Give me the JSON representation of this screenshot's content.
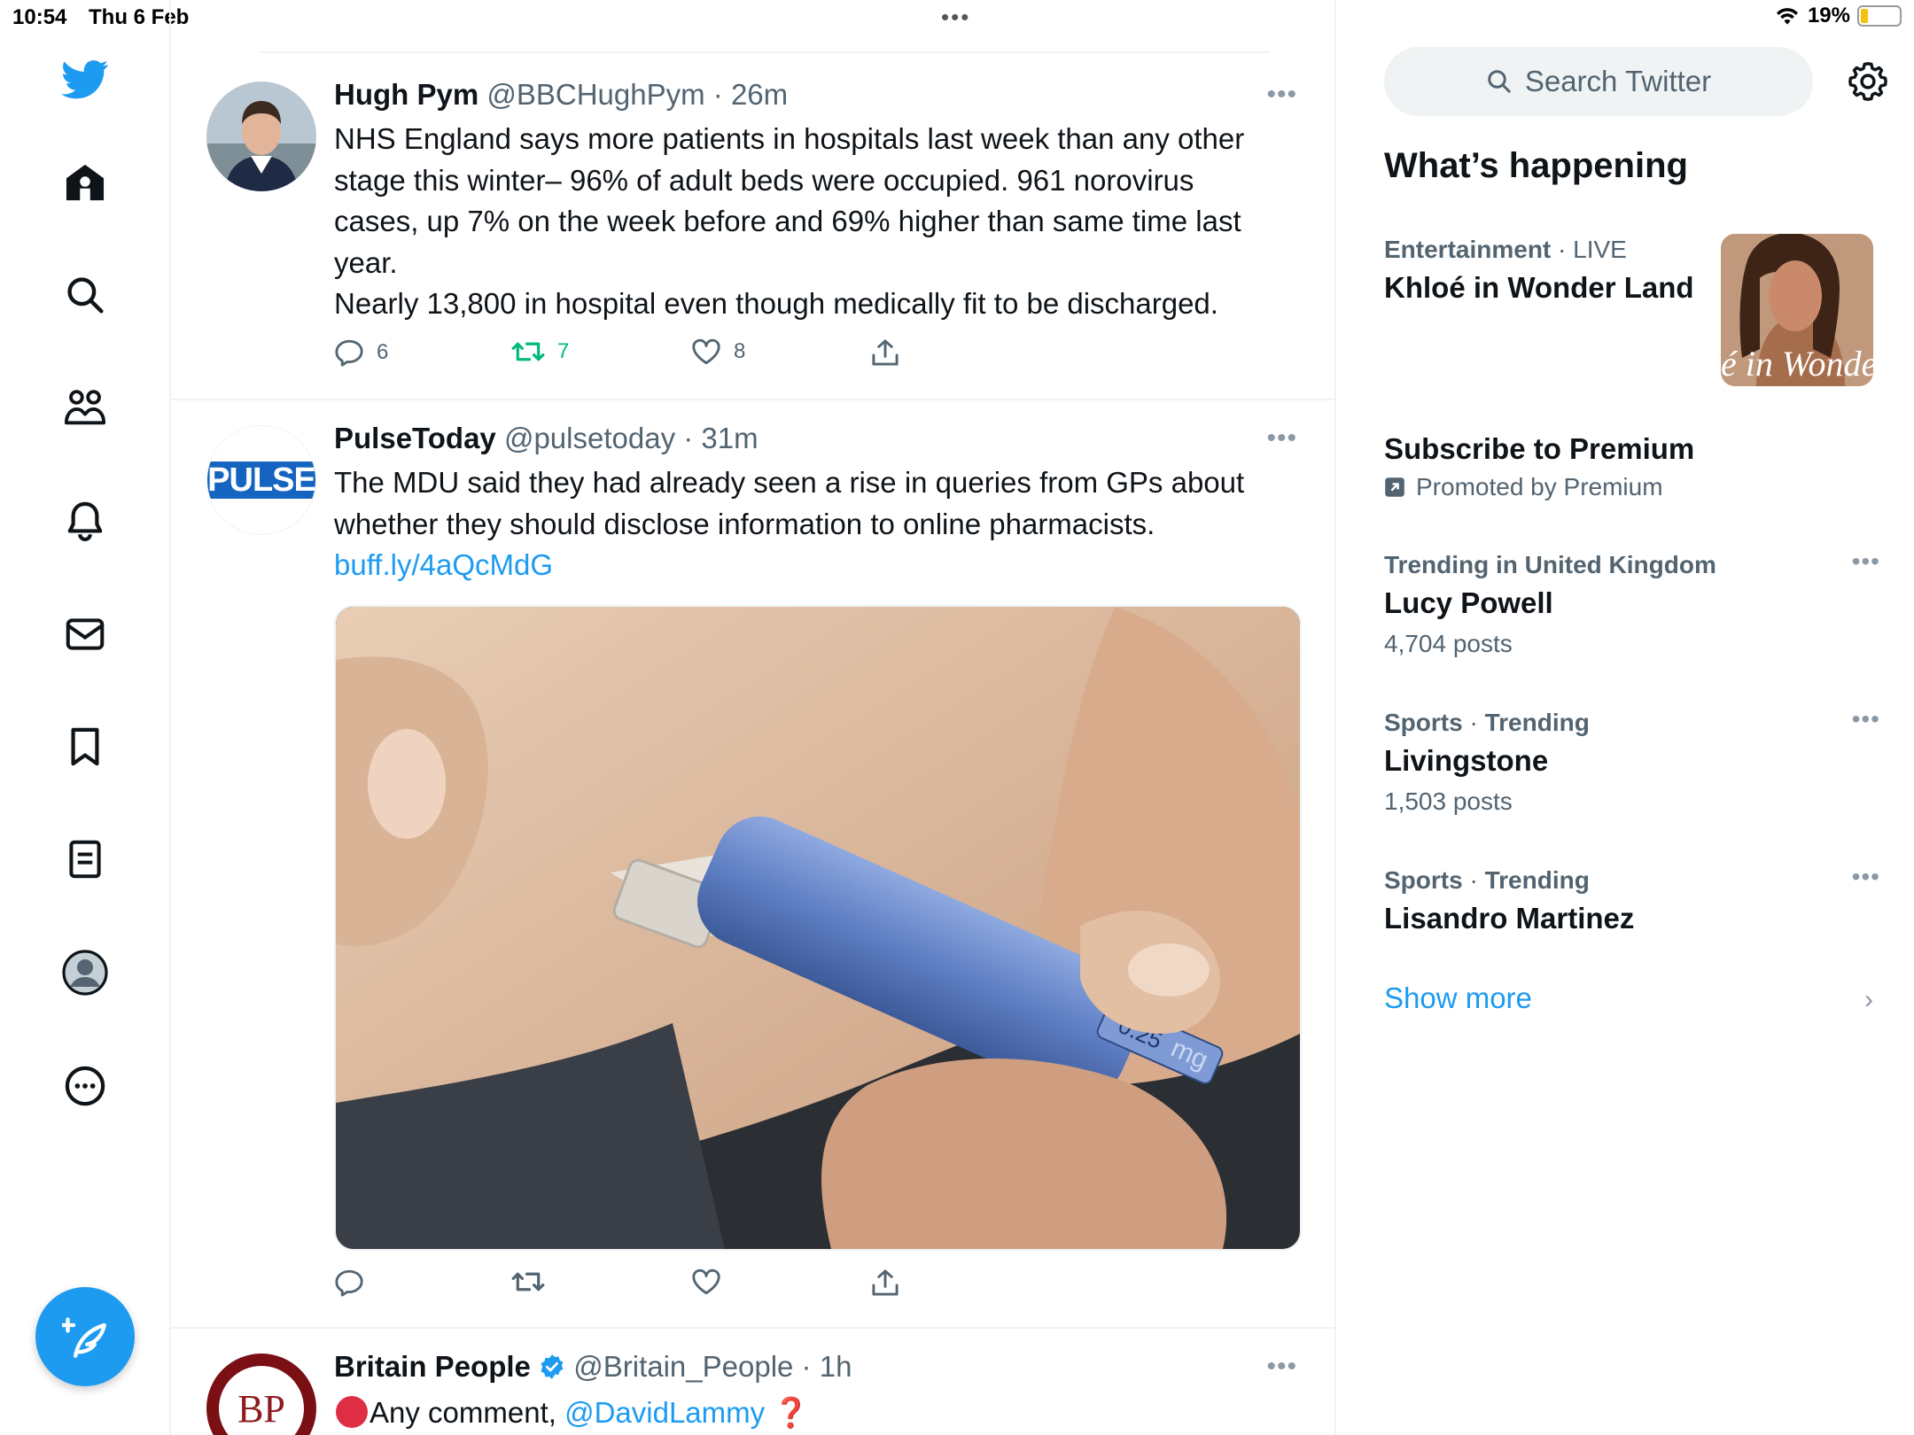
{
  "status_bar": {
    "time": "10:54",
    "date": "Thu 6 Feb",
    "battery_pct": "19%",
    "battery_level": 0.19
  },
  "nav": {
    "items": [
      "twitter-logo",
      "home",
      "explore",
      "communities",
      "notifications",
      "messages",
      "bookmarks",
      "lists",
      "profile",
      "more"
    ]
  },
  "tweets": [
    {
      "name": "Hugh Pym",
      "handle": "@BBCHughPym",
      "time": "26m",
      "text_lines": [
        "NHS England says more patients in hospitals last week than any other",
        "stage this winter– 96% of adult beds were occupied. 961 norovirus",
        "cases, up 7% on the week before and 69% higher than same time last",
        "year.",
        "Nearly 13,800 in hospital even though medically fit to be discharged."
      ],
      "replies": "6",
      "retweets": "7",
      "likes": "8"
    },
    {
      "name": "PulseToday",
      "handle": "@pulsetoday",
      "time": "31m",
      "avatar_text": "PULSE",
      "text_lines": [
        "The MDU said they had already seen a rise in queries from GPs about",
        "whether they should disclose information to online pharmacists."
      ],
      "link": "buff.ly/4aQcMdG",
      "media_label_dose": "0.25",
      "media_label_unit": "mg"
    },
    {
      "name": "Britain People",
      "handle": "@Britain_People",
      "time": "1h",
      "avatar_text": "BP",
      "text_prefix": "Any comment, ",
      "mention": "@DavidLammy",
      "text_suffix": "❓"
    }
  ],
  "sidebar": {
    "search_placeholder": "Search Twitter",
    "section_title": "What’s happening",
    "trends": [
      {
        "category": "Entertainment",
        "status": "LIVE",
        "title": "Khloé in Wonder Land",
        "thumb_text": "é in Wonder L"
      },
      {
        "title": "Subscribe to Premium",
        "promo": "Promoted by Premium"
      },
      {
        "category": "Trending in United Kingdom",
        "title": "Lucy Powell",
        "count": "4,704 posts"
      },
      {
        "category": "Sports",
        "status": "Trending",
        "title": "Livingstone",
        "count": "1,503 posts"
      },
      {
        "category": "Sports",
        "status": "Trending",
        "title": "Lisandro Martinez"
      }
    ],
    "show_more": "Show more"
  },
  "colors": {
    "accent": "#1d9bf0",
    "retweet": "#00ba7c",
    "muted": "#536471"
  }
}
